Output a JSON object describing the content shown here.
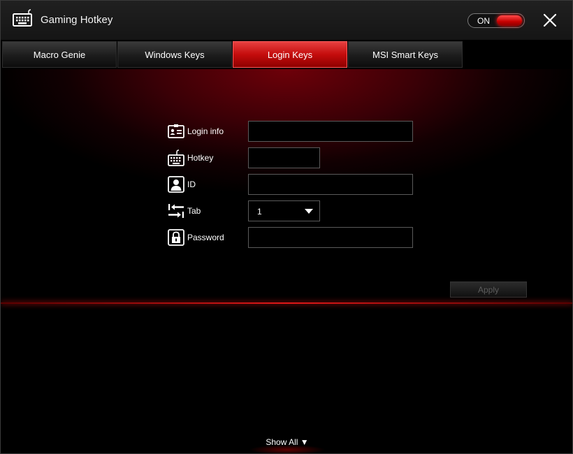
{
  "app": {
    "title": "Gaming Hotkey",
    "toggle_label": "ON",
    "accent_color": "#d10a0a"
  },
  "tabs": [
    {
      "label": "Macro Genie",
      "active": false
    },
    {
      "label": "Windows Keys",
      "active": false
    },
    {
      "label": "Login Keys",
      "active": true
    },
    {
      "label": "MSI Smart Keys",
      "active": false
    }
  ],
  "form": {
    "login_info": {
      "label": "Login info",
      "value": "",
      "icon": "id-card-icon"
    },
    "hotkey": {
      "label": "Hotkey",
      "value": "",
      "icon": "keyboard-icon"
    },
    "id": {
      "label": "ID",
      "value": "",
      "icon": "user-icon"
    },
    "tab": {
      "label": "Tab",
      "value": "1",
      "icon": "tab-arrows-icon"
    },
    "password": {
      "label": "Password",
      "value": "",
      "icon": "lock-icon"
    }
  },
  "buttons": {
    "apply": "Apply",
    "show_all": "Show All ▼"
  }
}
